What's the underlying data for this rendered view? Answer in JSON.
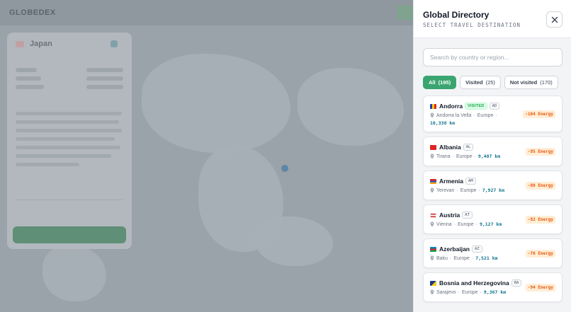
{
  "background": {
    "logo": "GLOBEDEX",
    "panel_title": "Japan"
  },
  "drawer": {
    "title": "Global Directory",
    "subtitle": "SELECT TRAVEL DESTINATION",
    "close_icon": "close-icon",
    "search_placeholder": "Search by country or region...",
    "search_value": "",
    "filters": [
      {
        "label": "All",
        "count": "(195)",
        "active": true
      },
      {
        "label": "Visited",
        "count": "(25)",
        "active": false
      },
      {
        "label": "Not visited",
        "count": "(170)",
        "active": false
      }
    ],
    "countries": [
      {
        "name": "Andorra",
        "visited": "VISITED",
        "code": "AD",
        "capital": "Andorra la Vella",
        "region": "Europe",
        "distance": "10,338 km",
        "energy": "-104 Energy",
        "flag_color": "#1e40af",
        "flag_color2": "#facc15"
      },
      {
        "name": "Albania",
        "code": "AL",
        "capital": "Tirana",
        "region": "Europe",
        "distance": "9,487 km",
        "energy": "-95 Energy",
        "flag_color": "#dc2626",
        "flag_color2": "#111827"
      },
      {
        "name": "Armenia",
        "code": "AM",
        "capital": "Yerevan",
        "region": "Europe",
        "distance": "7,927 km",
        "energy": "-80 Energy",
        "flag_color": "#dc2626",
        "flag_color2": "#1d4ed8"
      },
      {
        "name": "Austria",
        "code": "AT",
        "capital": "Vienna",
        "region": "Europe",
        "distance": "9,127 km",
        "energy": "-92 Energy",
        "flag_color": "#dc2626",
        "flag_color2": "#ffffff"
      },
      {
        "name": "Azerbaijan",
        "code": "AZ",
        "capital": "Baku",
        "region": "Europe",
        "distance": "7,521 km",
        "energy": "-76 Energy",
        "flag_color": "#0284c7",
        "flag_color2": "#16a34a"
      },
      {
        "name": "Bosnia and Herzegovina",
        "code": "BA",
        "capital": "Sarajevo",
        "region": "Europe",
        "distance": "9,367 km",
        "energy": "-94 Energy",
        "flag_color": "#1e3a8a",
        "flag_color2": "#facc15"
      }
    ],
    "separator": "·"
  }
}
